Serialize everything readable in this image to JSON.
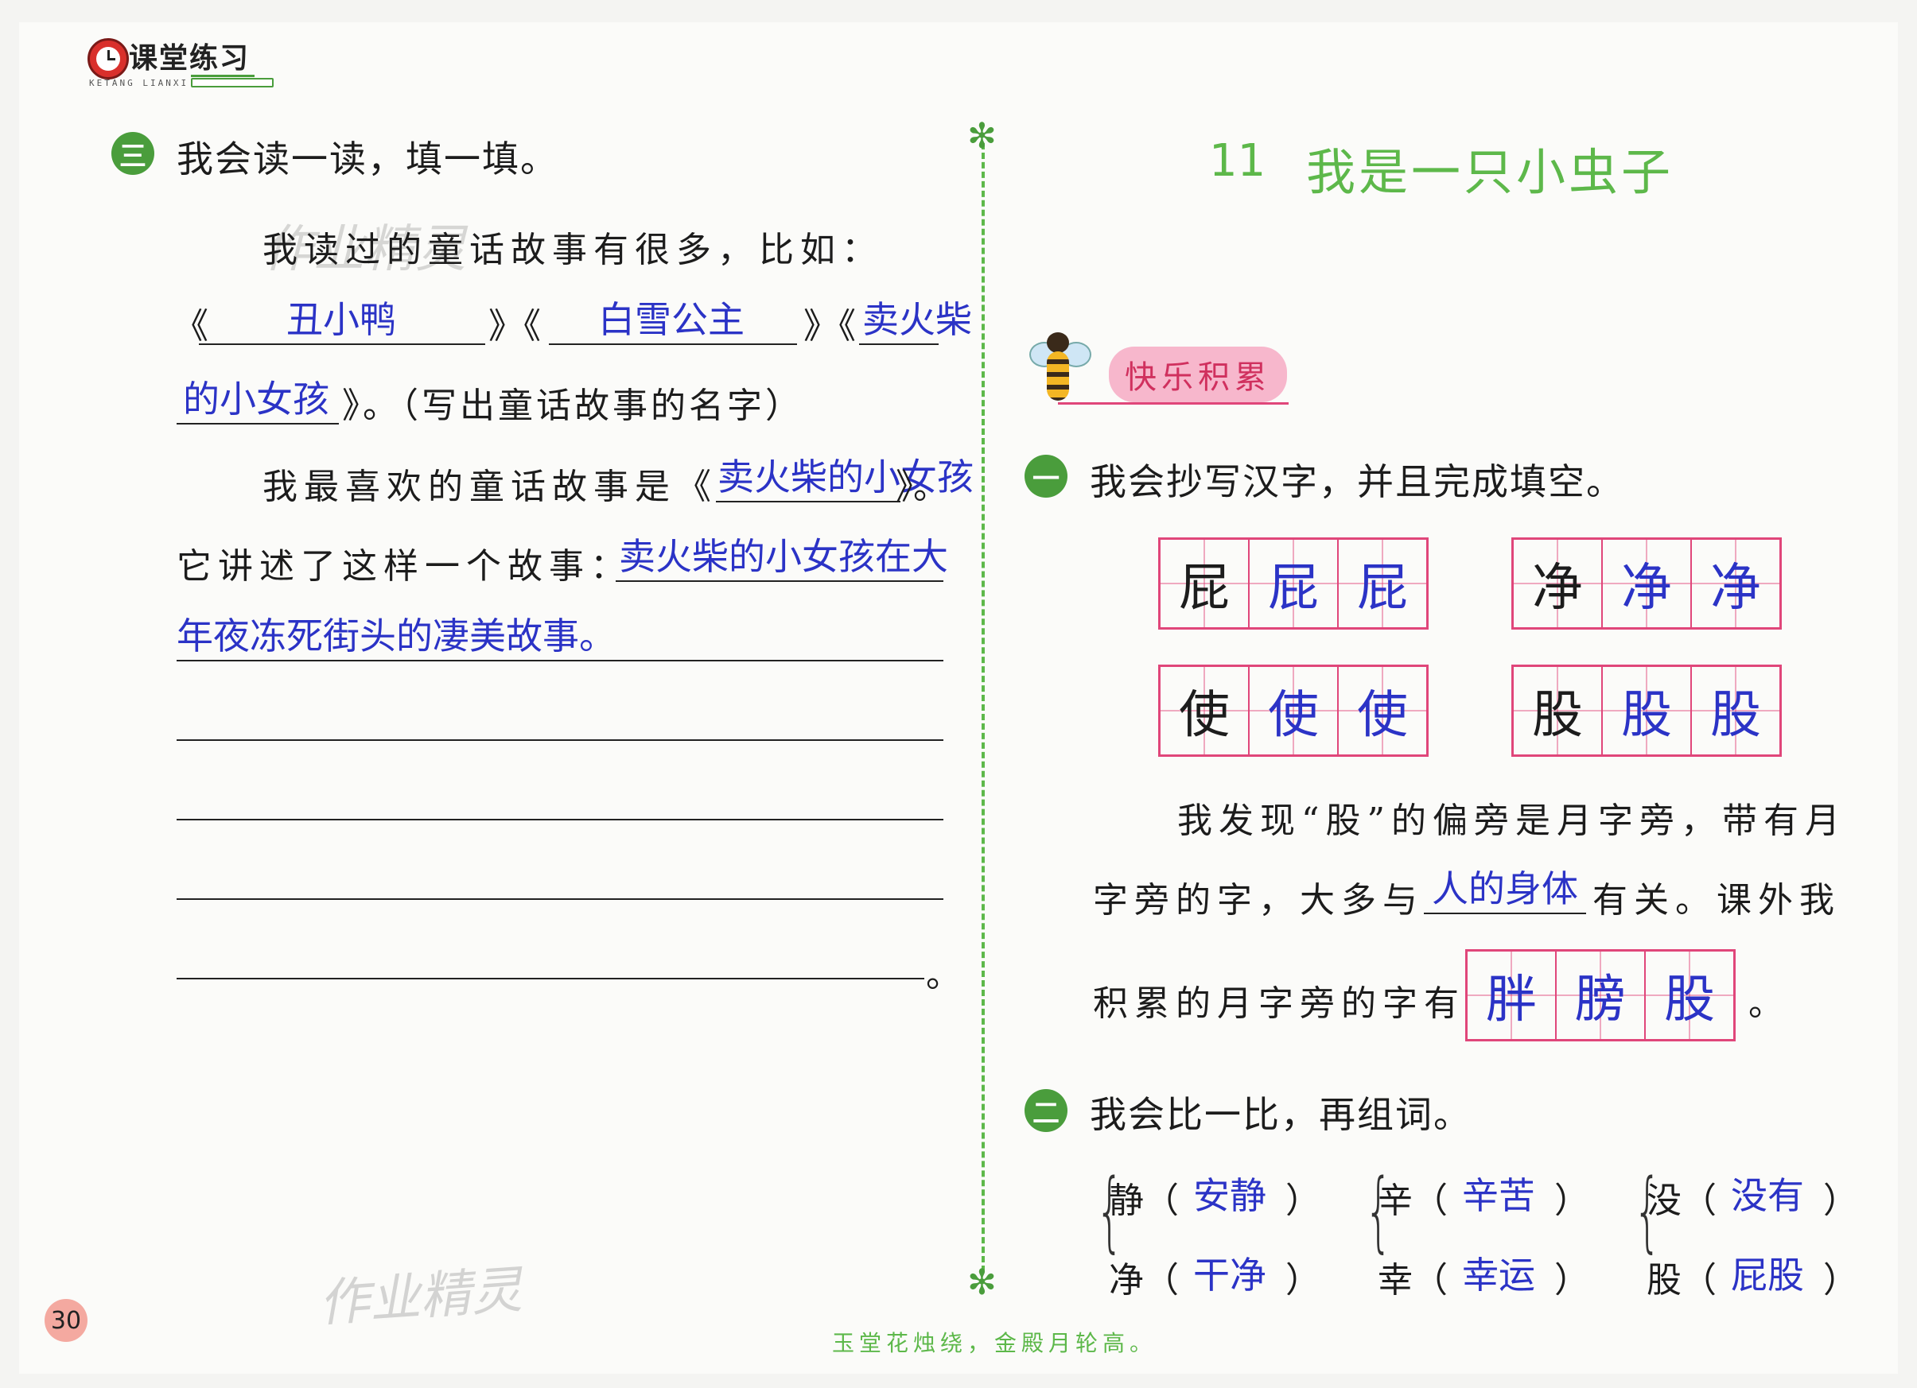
{
  "header": {
    "logo_text": "课堂练习",
    "logo_pinyin": "KETANG LIANXI"
  },
  "left": {
    "section_number": "三",
    "section_title": "我会读一读，填一填。",
    "line1": "我读过的童话故事有很多，比如：",
    "book1": "丑小鸭",
    "book2": "白雪公主",
    "book3_part1": "卖火柴",
    "book3_part2": "的小女孩",
    "open_q": "《",
    "close_open": "》《",
    "close_note": "》。（写出童话故事的名字）",
    "fav_prefix": "我最喜欢的童话故事是《",
    "fav_answer": "卖火柴的小女孩",
    "fav_suffix": "》。",
    "story_prefix": "它讲述了这样一个故事：",
    "story_answer_1": "卖火柴的小女孩在大",
    "story_answer_2": "年夜冻死街头的凄美故事。",
    "end_mark": "。",
    "watermark": "作业精灵"
  },
  "right": {
    "lesson_number": "11",
    "lesson_title": "我是一只小虫子",
    "badge": "快乐积累",
    "q1_number": "一",
    "q1_title": "我会抄写汉字，并且完成填空。",
    "grids": [
      {
        "printed": "屁",
        "written": [
          "屁",
          "屁"
        ]
      },
      {
        "printed": "净",
        "written": [
          "净",
          "净"
        ]
      },
      {
        "printed": "使",
        "written": [
          "使",
          "使"
        ]
      },
      {
        "printed": "股",
        "written": [
          "股",
          "股"
        ]
      }
    ],
    "find_line1": "我发现“股”的偏旁是月字旁，带有月",
    "find_line2_prefix": "字旁的字，大多与",
    "find_answer": "人的身体",
    "find_line2_suffix": "有关。课外我",
    "find_line3_prefix": "积累的月字旁的字有",
    "collected": [
      "胖",
      "膀",
      "股"
    ],
    "find_line3_suffix": "。",
    "q2_number": "二",
    "q2_title": "我会比一比，再组词。",
    "pairs": [
      {
        "a_char": "静",
        "a_word": "安静",
        "b_char": "净",
        "b_word": "干净"
      },
      {
        "a_char": "辛",
        "a_word": "辛苦",
        "b_char": "幸",
        "b_word": "幸运"
      },
      {
        "a_char": "没",
        "a_word": "没有",
        "b_char": "股",
        "b_word": "屁股"
      }
    ],
    "paren_open": "（",
    "paren_close": "）"
  },
  "footer": {
    "page_number": "30",
    "motto": "玉堂花烛绕，金殿月轮高。"
  },
  "colors": {
    "accent_green": "#4a9d3c",
    "title_green": "#5db84a",
    "grid_pink": "#e0467a",
    "handwriting_blue": "#2b33c6"
  }
}
